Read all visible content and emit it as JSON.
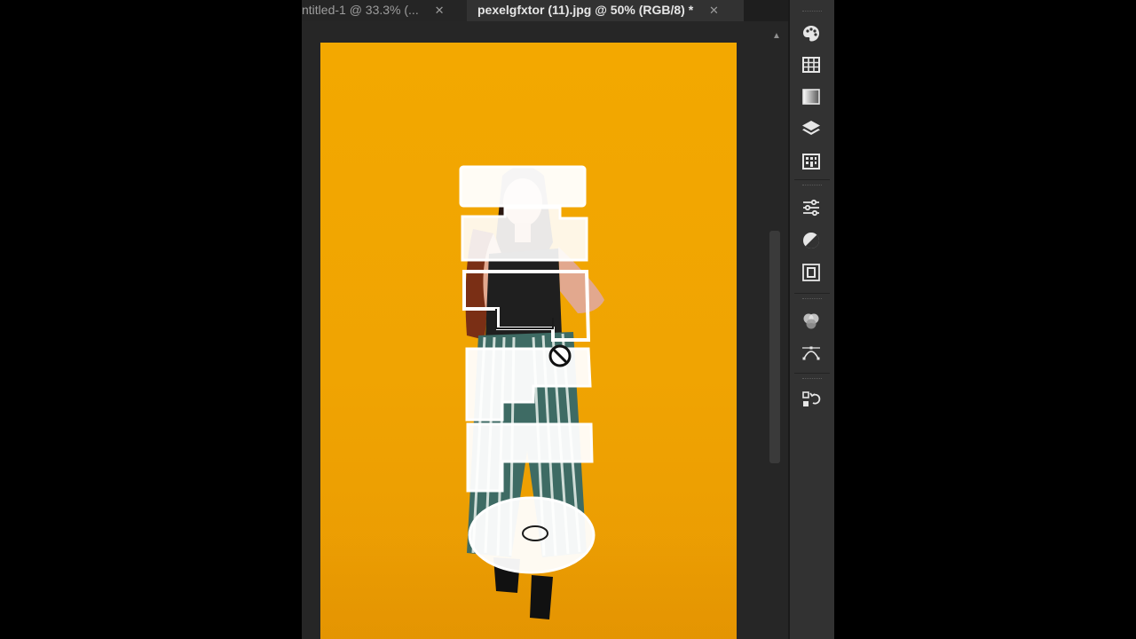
{
  "tabs": [
    {
      "label": "ntitled-1 @ 33.3% (...",
      "close": "✕",
      "active": false
    },
    {
      "label": "pexelgfxtor (11).jpg @ 50% (RGB/8) *",
      "close": "✕",
      "active": true
    }
  ],
  "colors": {
    "app_background": "#282828",
    "canvas_orange": "#f0a402",
    "selection_white": "#ffffff"
  },
  "tool_strip": {
    "items": [
      {
        "name": "color-palette-icon"
      },
      {
        "name": "swatches-grid-icon"
      },
      {
        "name": "gradient-icon"
      },
      {
        "name": "layers-icon"
      },
      {
        "name": "patterns-icon"
      },
      {
        "name": "adjustments-sliders-icon"
      },
      {
        "name": "adjustment-circle-icon"
      },
      {
        "name": "masks-icon"
      },
      {
        "name": "channels-icon"
      },
      {
        "name": "paths-icon"
      },
      {
        "name": "history-icon"
      }
    ]
  },
  "cursor": {
    "name": "not-allowed-cursor-icon"
  }
}
